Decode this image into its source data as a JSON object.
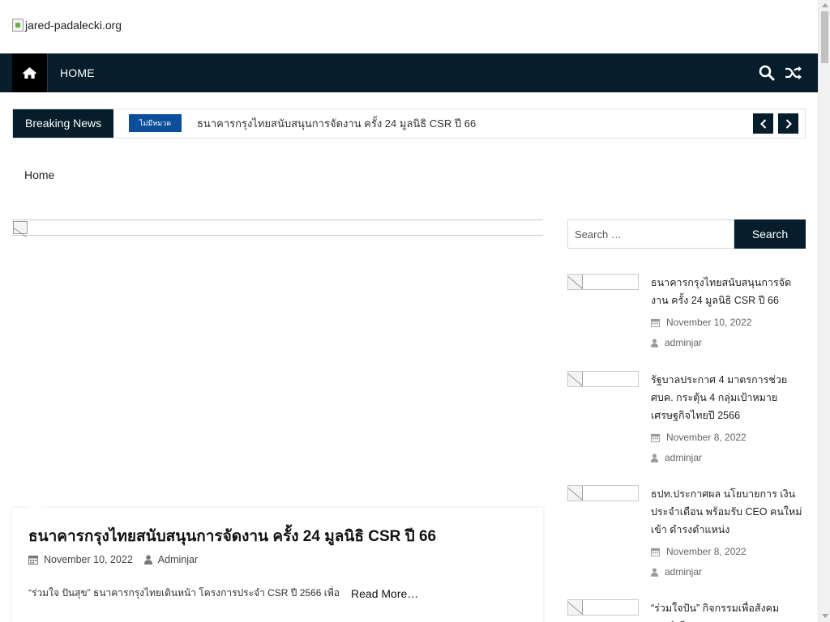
{
  "header": {
    "logo_alt": "jared-padalecki.org"
  },
  "nav": {
    "items": [
      {
        "label": "HOME"
      }
    ],
    "icons": {
      "home": "home-icon",
      "search": "search-icon",
      "random": "random-icon"
    }
  },
  "breaking": {
    "label": "Breaking News",
    "badge": "ไม่มีหมวด",
    "headline": "ธนาคารกรุงไทยสนับสนุนการจัดงาน ครั้ง 24 มูลนิธิ CSR ปี 66"
  },
  "breadcrumb": {
    "home": "Home"
  },
  "main_post": {
    "title": "ธนาคารกรุงไทยสนับสนุนการจัดงาน ครั้ง 24 มูลนิธิ CSR ปี 66",
    "date": "November 10, 2022",
    "author": "Adminjar",
    "excerpt": "“ร่วมใจ ปันสุข” ธนาคารกรุงไทยเดินหน้า โครงการประจำ CSR ปี 2566 เพื่อ",
    "read_more": "Read More…"
  },
  "sidebar": {
    "search_placeholder": "Search …",
    "search_button": "Search",
    "recent_posts": [
      {
        "title": "ธนาคารกรุงไทยสนับสนุนการจัดงาน ครั้ง 24 มูลนิธิ CSR ปี 66",
        "date": "November 10, 2022",
        "author": "adminjar"
      },
      {
        "title": "รัฐบาลประกาศ 4 มาตรการช่วย ศบค. กระตุ้น 4 กลุ่มเป้าหมายเศรษฐกิจไทยปี 2566",
        "date": "November 8, 2022",
        "author": "adminjar"
      },
      {
        "title": "ธปท.ประกาศผล นโยบายการ เงิน ประจำเดือน พร้อมรับ CEO คนใหม่เข้า ดำรงตำแหน่ง",
        "date": "November 8, 2022",
        "author": "adminjar"
      },
      {
        "title": "“ร่วมใจปัน” กิจกรรมเพื่อสังคมประจำปี"
      }
    ]
  },
  "colors": {
    "navy": "#061d2b",
    "badge_blue": "#0b4f9c"
  }
}
